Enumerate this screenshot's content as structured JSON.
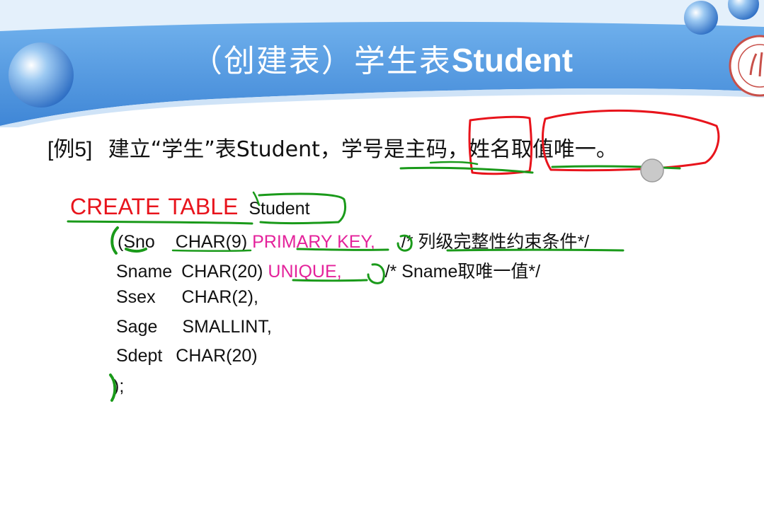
{
  "slide": {
    "title_cn": "（创建表）学生表",
    "title_en": "Student"
  },
  "example": {
    "tag": "[例5]",
    "text": "建立“学生”表Student，学号是主码，姓名取值唯一。"
  },
  "code": {
    "create": "CREATE",
    "table": "TABLE",
    "table_name": "Student",
    "lines": [
      {
        "col": "(Sno",
        "type": "CHAR(9)",
        "constraint": "PRIMARY KEY,",
        "comment_en": "/*",
        "comment_cn": "列级完整性约束条件",
        "comment_end": "*/"
      },
      {
        "col": "Sname",
        "type": "CHAR(20)",
        "constraint": "UNIQUE,",
        "comment_en": "/* Sname",
        "comment_cn": "取唯一值",
        "comment_end": "*/"
      },
      {
        "col": "Ssex",
        "type": "CHAR(2),"
      },
      {
        "col": "Sage",
        "type": "SMALLINT,"
      },
      {
        "col": "Sdept",
        "type": "CHAR(20)"
      }
    ],
    "close": ");"
  },
  "colors": {
    "banner": "#5b9ee0",
    "keyword": "#e8141c",
    "constraint": "#e4229b",
    "ink_green": "#1a9a1a",
    "ink_red": "#e8141c"
  }
}
